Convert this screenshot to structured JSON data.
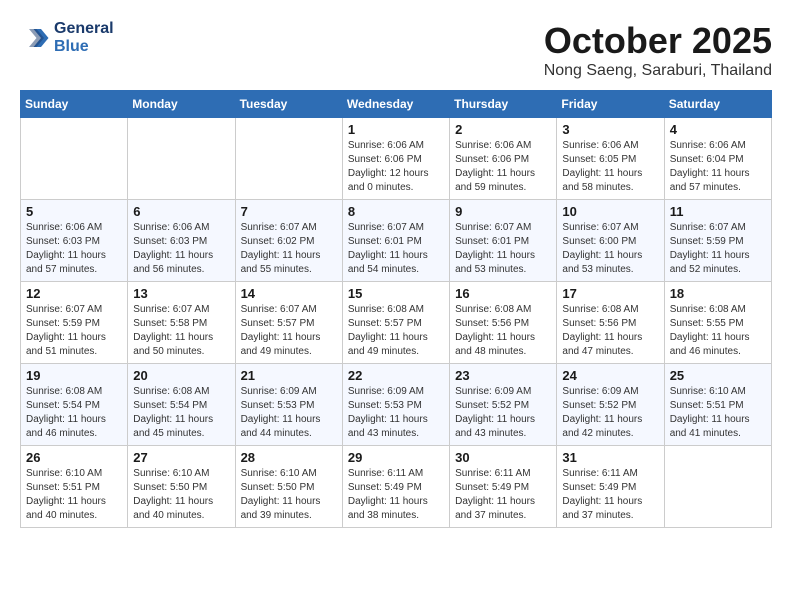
{
  "header": {
    "logo_line1": "General",
    "logo_line2": "Blue",
    "month": "October 2025",
    "location": "Nong Saeng, Saraburi, Thailand"
  },
  "weekdays": [
    "Sunday",
    "Monday",
    "Tuesday",
    "Wednesday",
    "Thursday",
    "Friday",
    "Saturday"
  ],
  "weeks": [
    [
      {
        "day": "",
        "info": ""
      },
      {
        "day": "",
        "info": ""
      },
      {
        "day": "",
        "info": ""
      },
      {
        "day": "1",
        "info": "Sunrise: 6:06 AM\nSunset: 6:06 PM\nDaylight: 12 hours\nand 0 minutes."
      },
      {
        "day": "2",
        "info": "Sunrise: 6:06 AM\nSunset: 6:06 PM\nDaylight: 11 hours\nand 59 minutes."
      },
      {
        "day": "3",
        "info": "Sunrise: 6:06 AM\nSunset: 6:05 PM\nDaylight: 11 hours\nand 58 minutes."
      },
      {
        "day": "4",
        "info": "Sunrise: 6:06 AM\nSunset: 6:04 PM\nDaylight: 11 hours\nand 57 minutes."
      }
    ],
    [
      {
        "day": "5",
        "info": "Sunrise: 6:06 AM\nSunset: 6:03 PM\nDaylight: 11 hours\nand 57 minutes."
      },
      {
        "day": "6",
        "info": "Sunrise: 6:06 AM\nSunset: 6:03 PM\nDaylight: 11 hours\nand 56 minutes."
      },
      {
        "day": "7",
        "info": "Sunrise: 6:07 AM\nSunset: 6:02 PM\nDaylight: 11 hours\nand 55 minutes."
      },
      {
        "day": "8",
        "info": "Sunrise: 6:07 AM\nSunset: 6:01 PM\nDaylight: 11 hours\nand 54 minutes."
      },
      {
        "day": "9",
        "info": "Sunrise: 6:07 AM\nSunset: 6:01 PM\nDaylight: 11 hours\nand 53 minutes."
      },
      {
        "day": "10",
        "info": "Sunrise: 6:07 AM\nSunset: 6:00 PM\nDaylight: 11 hours\nand 53 minutes."
      },
      {
        "day": "11",
        "info": "Sunrise: 6:07 AM\nSunset: 5:59 PM\nDaylight: 11 hours\nand 52 minutes."
      }
    ],
    [
      {
        "day": "12",
        "info": "Sunrise: 6:07 AM\nSunset: 5:59 PM\nDaylight: 11 hours\nand 51 minutes."
      },
      {
        "day": "13",
        "info": "Sunrise: 6:07 AM\nSunset: 5:58 PM\nDaylight: 11 hours\nand 50 minutes."
      },
      {
        "day": "14",
        "info": "Sunrise: 6:07 AM\nSunset: 5:57 PM\nDaylight: 11 hours\nand 49 minutes."
      },
      {
        "day": "15",
        "info": "Sunrise: 6:08 AM\nSunset: 5:57 PM\nDaylight: 11 hours\nand 49 minutes."
      },
      {
        "day": "16",
        "info": "Sunrise: 6:08 AM\nSunset: 5:56 PM\nDaylight: 11 hours\nand 48 minutes."
      },
      {
        "day": "17",
        "info": "Sunrise: 6:08 AM\nSunset: 5:56 PM\nDaylight: 11 hours\nand 47 minutes."
      },
      {
        "day": "18",
        "info": "Sunrise: 6:08 AM\nSunset: 5:55 PM\nDaylight: 11 hours\nand 46 minutes."
      }
    ],
    [
      {
        "day": "19",
        "info": "Sunrise: 6:08 AM\nSunset: 5:54 PM\nDaylight: 11 hours\nand 46 minutes."
      },
      {
        "day": "20",
        "info": "Sunrise: 6:08 AM\nSunset: 5:54 PM\nDaylight: 11 hours\nand 45 minutes."
      },
      {
        "day": "21",
        "info": "Sunrise: 6:09 AM\nSunset: 5:53 PM\nDaylight: 11 hours\nand 44 minutes."
      },
      {
        "day": "22",
        "info": "Sunrise: 6:09 AM\nSunset: 5:53 PM\nDaylight: 11 hours\nand 43 minutes."
      },
      {
        "day": "23",
        "info": "Sunrise: 6:09 AM\nSunset: 5:52 PM\nDaylight: 11 hours\nand 43 minutes."
      },
      {
        "day": "24",
        "info": "Sunrise: 6:09 AM\nSunset: 5:52 PM\nDaylight: 11 hours\nand 42 minutes."
      },
      {
        "day": "25",
        "info": "Sunrise: 6:10 AM\nSunset: 5:51 PM\nDaylight: 11 hours\nand 41 minutes."
      }
    ],
    [
      {
        "day": "26",
        "info": "Sunrise: 6:10 AM\nSunset: 5:51 PM\nDaylight: 11 hours\nand 40 minutes."
      },
      {
        "day": "27",
        "info": "Sunrise: 6:10 AM\nSunset: 5:50 PM\nDaylight: 11 hours\nand 40 minutes."
      },
      {
        "day": "28",
        "info": "Sunrise: 6:10 AM\nSunset: 5:50 PM\nDaylight: 11 hours\nand 39 minutes."
      },
      {
        "day": "29",
        "info": "Sunrise: 6:11 AM\nSunset: 5:49 PM\nDaylight: 11 hours\nand 38 minutes."
      },
      {
        "day": "30",
        "info": "Sunrise: 6:11 AM\nSunset: 5:49 PM\nDaylight: 11 hours\nand 37 minutes."
      },
      {
        "day": "31",
        "info": "Sunrise: 6:11 AM\nSunset: 5:49 PM\nDaylight: 11 hours\nand 37 minutes."
      },
      {
        "day": "",
        "info": ""
      }
    ]
  ]
}
